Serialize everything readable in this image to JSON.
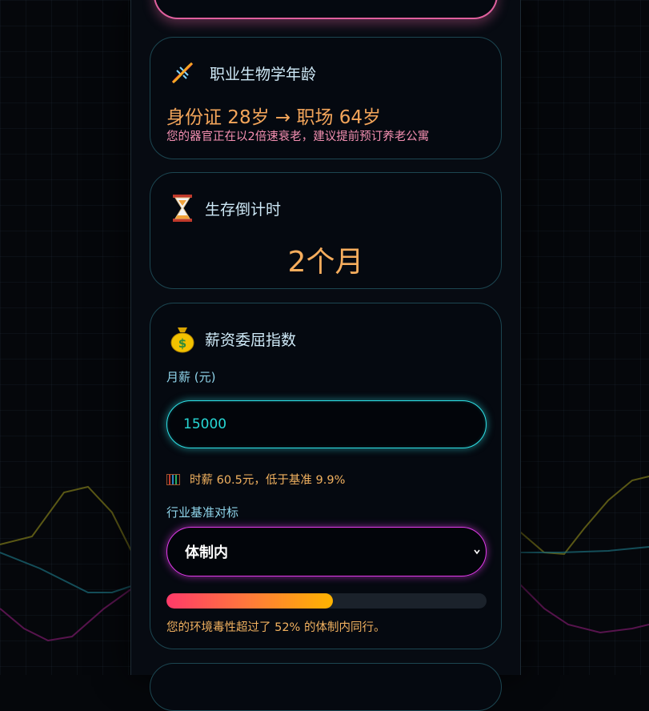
{
  "bio_age": {
    "title": "职业生物学年龄",
    "icon": "dna-icon",
    "headline": "身份证 28岁 → 职场 64岁",
    "note": "您的器官正在以2倍速衰老，建议提前预订养老公寓"
  },
  "countdown": {
    "title": "生存倒计时",
    "icon": "hourglass-icon",
    "value": "2个月"
  },
  "salary": {
    "title": "薪资委屈指数",
    "icon": "money-bag-icon",
    "input_label": "月薪 (元)",
    "input_value": "15000",
    "hourly_icon": "abacus-icon",
    "hourly_text": "时薪 60.5元，低于基准 9.9%",
    "benchmark_label": "行业基准对标",
    "benchmark_selected": "体制内",
    "toxicity_percent": 52,
    "toxicity_text": "您的环境毒性超过了 52% 的体制内同行。"
  },
  "colors": {
    "accent_cyan": "#2fe1e6",
    "accent_magenta": "#e13bea",
    "accent_orange": "#f3a55a",
    "accent_pink": "#f48fb1",
    "top_card_border": "#e0609e"
  }
}
